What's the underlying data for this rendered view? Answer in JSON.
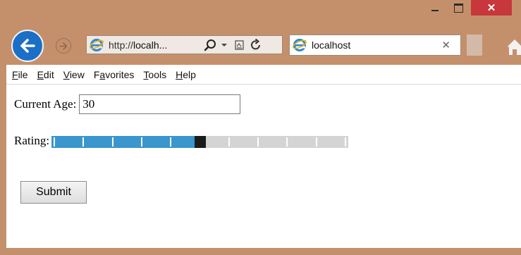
{
  "window": {
    "close_glyph": "✕"
  },
  "nav": {
    "url_protocol": "http://",
    "url_host": "localh...",
    "tab_title": "localhost",
    "tab_close_glyph": "✕"
  },
  "menu": [
    {
      "label": "File",
      "accel": "F",
      "rest": "ile"
    },
    {
      "label": "Edit",
      "accel": "E",
      "rest": "dit"
    },
    {
      "label": "View",
      "accel": "V",
      "rest": "iew"
    },
    {
      "label": "Favorites",
      "accel_pre": "F",
      "accel": "a",
      "rest": "vorites"
    },
    {
      "label": "Tools",
      "accel": "T",
      "rest": "ools"
    },
    {
      "label": "Help",
      "accel": "H",
      "rest": "elp"
    }
  ],
  "form": {
    "age_label": "Current Age:",
    "age_value": "30",
    "rating_label": "Rating:",
    "rating_level_fraction": 0.5,
    "submit_label": "Submit"
  },
  "colors": {
    "frame": "#c4906b",
    "close_button": "#c7373b",
    "rating_fill": "#3a96cc",
    "rating_thumb": "#1b1b1b",
    "rating_track": "#d4d4d4"
  }
}
